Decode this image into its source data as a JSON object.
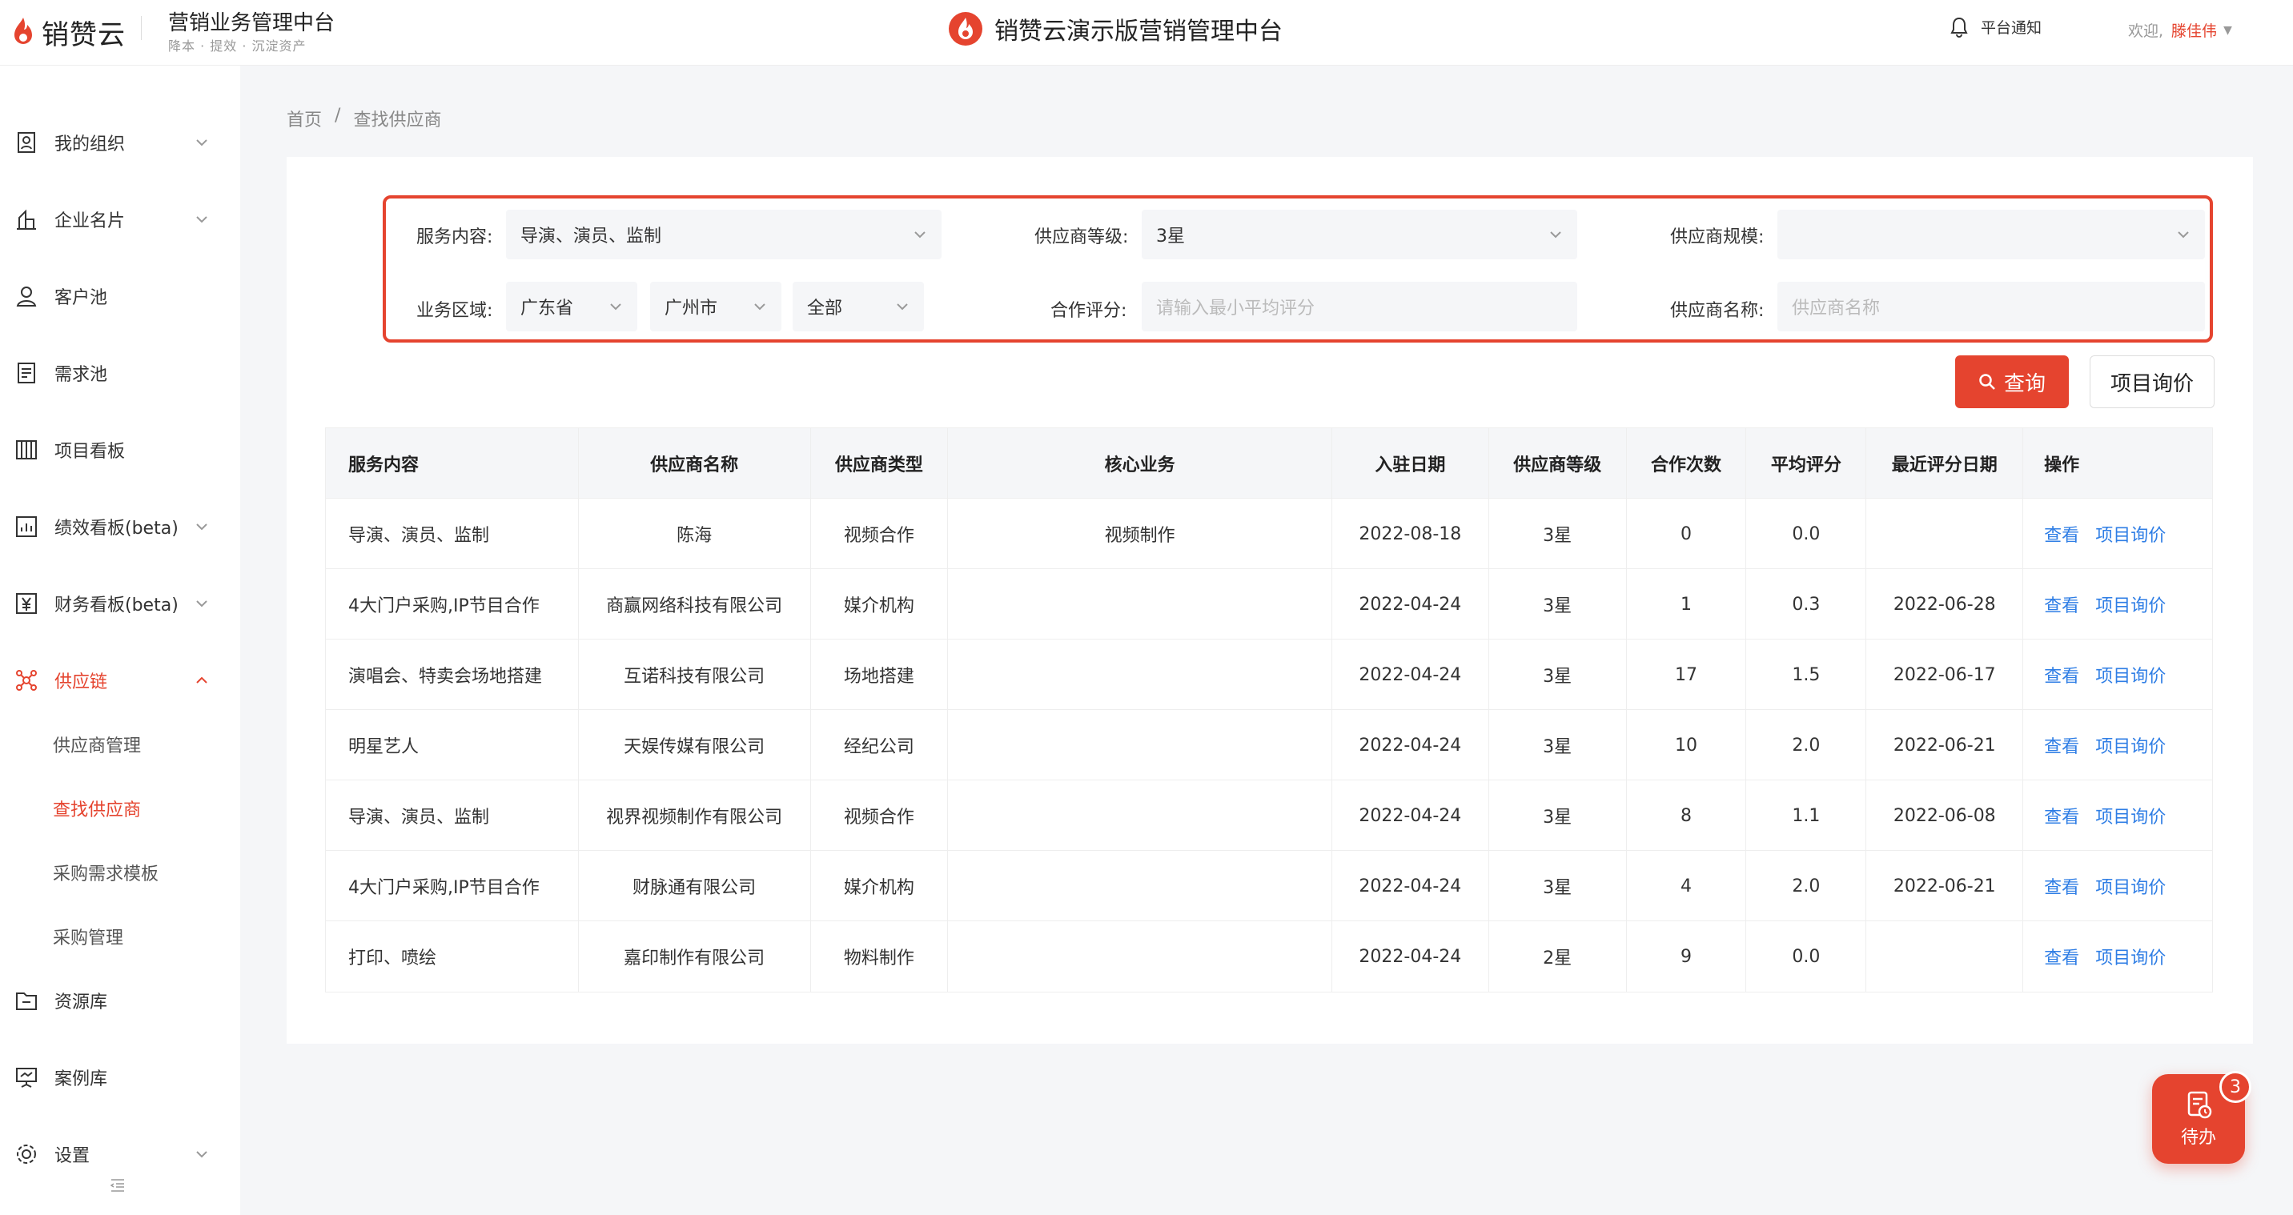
{
  "header": {
    "logo_text": "销赞云",
    "platform_name": "营销业务管理中台",
    "tagline": "降本 · 提效 · 沉淀资产",
    "center_title": "销赞云演示版营销管理中台",
    "notify_label": "平台通知",
    "welcome_label": "欢迎,",
    "user_name": "滕佳伟"
  },
  "sidebar": {
    "items": [
      {
        "label": "我的组织",
        "icon": "org-icon"
      },
      {
        "label": "企业名片",
        "icon": "building-icon"
      },
      {
        "label": "客户池",
        "icon": "user-icon"
      },
      {
        "label": "需求池",
        "icon": "document-icon"
      },
      {
        "label": "项目看板",
        "icon": "board-icon"
      },
      {
        "label": "绩效看板(beta)",
        "icon": "chart-icon"
      },
      {
        "label": "财务看板(beta)",
        "icon": "yen-icon"
      },
      {
        "label": "供应链",
        "icon": "network-icon"
      },
      {
        "label": "资源库",
        "icon": "folder-icon"
      },
      {
        "label": "案例库",
        "icon": "presentation-icon"
      },
      {
        "label": "设置",
        "icon": "gear-icon"
      }
    ],
    "sub_items": [
      "供应商管理",
      "查找供应商",
      "采购需求模板",
      "采购管理"
    ]
  },
  "breadcrumb": {
    "home": "首页",
    "separator": "/",
    "current": "查找供应商"
  },
  "filters": {
    "service_label": "服务内容:",
    "service_value": "导演、演员、监制",
    "level_label": "供应商等级:",
    "level_value": "3星",
    "scale_label": "供应商规模:",
    "scale_value": "",
    "region_label": "业务区域:",
    "province_value": "广东省",
    "city_value": "广州市",
    "district_value": "全部",
    "rating_label": "合作评分:",
    "rating_placeholder": "请输入最小平均评分",
    "name_label": "供应商名称:",
    "name_placeholder": "供应商名称"
  },
  "buttons": {
    "query": "查询",
    "inquiry": "项目询价"
  },
  "table": {
    "headers": [
      "服务内容",
      "供应商名称",
      "供应商类型",
      "核心业务",
      "入驻日期",
      "供应商等级",
      "合作次数",
      "平均评分",
      "最近评分日期",
      "操作"
    ],
    "rows": [
      {
        "service": "导演、演员、监制",
        "name": "陈海",
        "type": "视频合作",
        "core": "视频制作",
        "join_date": "2022-08-18",
        "level": "3星",
        "count": "0",
        "avg": "0.0",
        "last_date": ""
      },
      {
        "service": "4大门户采购,IP节目合作",
        "name": "商赢网络科技有限公司",
        "type": "媒介机构",
        "core": "",
        "join_date": "2022-04-24",
        "level": "3星",
        "count": "1",
        "avg": "0.3",
        "last_date": "2022-06-28"
      },
      {
        "service": "演唱会、特卖会场地搭建",
        "name": "互诺科技有限公司",
        "type": "场地搭建",
        "core": "",
        "join_date": "2022-04-24",
        "level": "3星",
        "count": "17",
        "avg": "1.5",
        "last_date": "2022-06-17"
      },
      {
        "service": "明星艺人",
        "name": "天娱传媒有限公司",
        "type": "经纪公司",
        "core": "",
        "join_date": "2022-04-24",
        "level": "3星",
        "count": "10",
        "avg": "2.0",
        "last_date": "2022-06-21"
      },
      {
        "service": "导演、演员、监制",
        "name": "视界视频制作有限公司",
        "type": "视频合作",
        "core": "",
        "join_date": "2022-04-24",
        "level": "3星",
        "count": "8",
        "avg": "1.1",
        "last_date": "2022-06-08"
      },
      {
        "service": "4大门户采购,IP节目合作",
        "name": "财脉通有限公司",
        "type": "媒介机构",
        "core": "",
        "join_date": "2022-04-24",
        "level": "3星",
        "count": "4",
        "avg": "2.0",
        "last_date": "2022-06-21"
      },
      {
        "service": "打印、喷绘",
        "name": "嘉印制作有限公司",
        "type": "物料制作",
        "core": "",
        "join_date": "2022-04-24",
        "level": "2星",
        "count": "9",
        "avg": "0.0",
        "last_date": ""
      }
    ],
    "op_view": "查看",
    "op_inquiry": "项目询价"
  },
  "todo": {
    "label": "待办",
    "count": "3"
  },
  "colors": {
    "accent": "#e5442f",
    "link": "#2f7ee5"
  }
}
